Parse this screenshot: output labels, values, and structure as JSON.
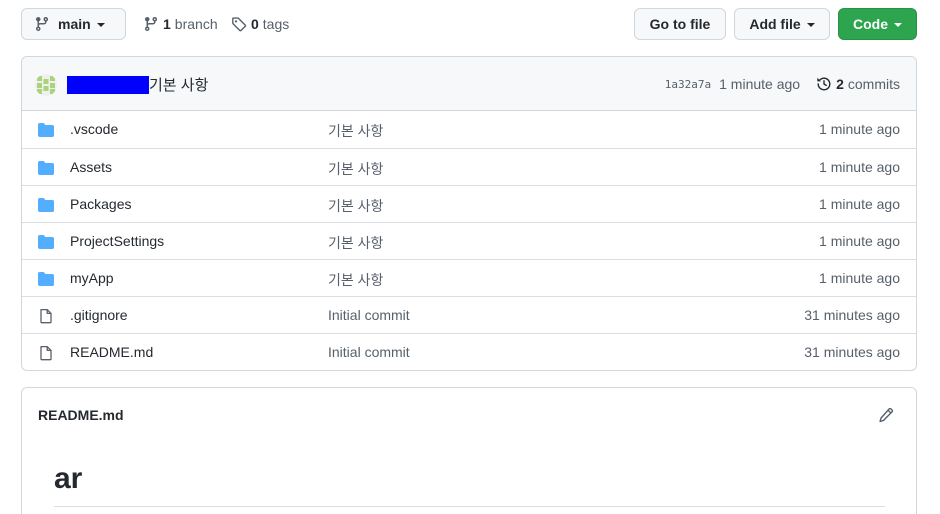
{
  "toolbar": {
    "branch_name": "main",
    "branch_count": "1",
    "branch_label": "branch",
    "tag_count": "0",
    "tag_label": "tags",
    "goto_file_label": "Go to file",
    "add_file_label": "Add file",
    "code_label": "Code"
  },
  "commit": {
    "message": "기본 사항",
    "sha": "1a32a7a",
    "time": "1 minute ago",
    "commits_count": "2",
    "commits_label": "commits"
  },
  "files": [
    {
      "name": ".vscode",
      "type": "folder",
      "message": "기본 사항",
      "age": "1 minute ago"
    },
    {
      "name": "Assets",
      "type": "folder",
      "message": "기본 사항",
      "age": "1 minute ago"
    },
    {
      "name": "Packages",
      "type": "folder",
      "message": "기본 사항",
      "age": "1 minute ago"
    },
    {
      "name": "ProjectSettings",
      "type": "folder",
      "message": "기본 사항",
      "age": "1 minute ago"
    },
    {
      "name": "myApp",
      "type": "folder",
      "message": "기본 사항",
      "age": "1 minute ago"
    },
    {
      "name": ".gitignore",
      "type": "file",
      "message": "Initial commit",
      "age": "31 minutes ago"
    },
    {
      "name": "README.md",
      "type": "file",
      "message": "Initial commit",
      "age": "31 minutes ago"
    }
  ],
  "readme": {
    "title": "README.md",
    "heading": "ar"
  },
  "colors": {
    "folder": "#54aeff",
    "file_icon": "#57606a",
    "code_button": "#2da44e",
    "redaction": "#0000ff"
  },
  "icons": {
    "branch": "git-branch-icon",
    "tag": "tag-icon",
    "history": "history-icon",
    "folder": "folder-icon",
    "file": "file-icon",
    "edit": "pencil-icon"
  }
}
